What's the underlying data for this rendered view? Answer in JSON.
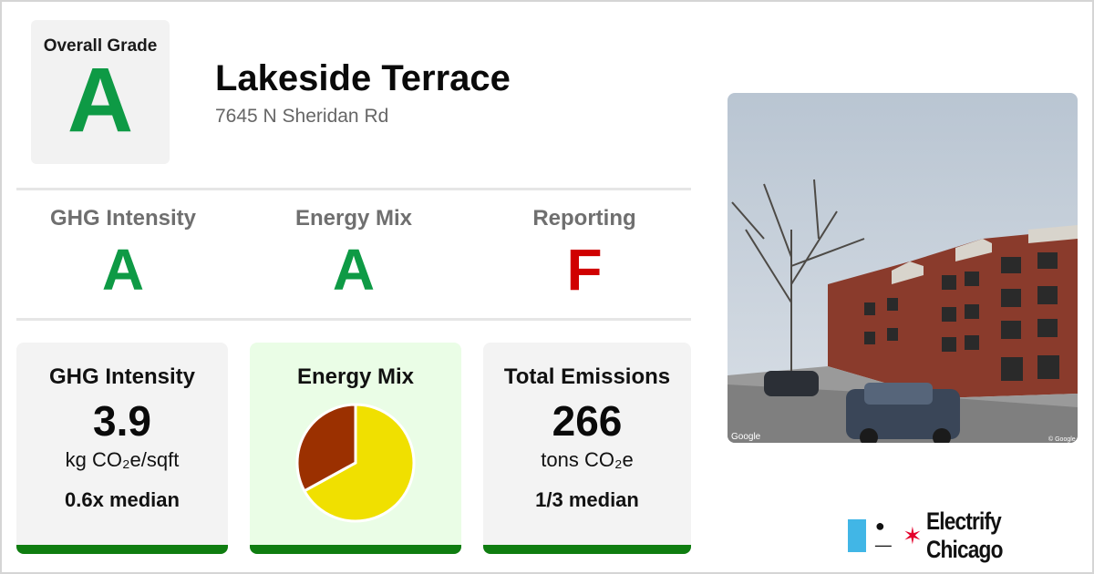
{
  "overall": {
    "label": "Overall Grade",
    "grade": "A",
    "grade_color": "#0e9a45"
  },
  "building": {
    "name": "Lakeside Terrace",
    "address": "7645 N Sheridan Rd"
  },
  "grades": [
    {
      "label": "GHG Intensity",
      "value": "A",
      "color": "#0e9a45"
    },
    {
      "label": "Energy Mix",
      "value": "A",
      "color": "#0e9a45"
    },
    {
      "label": "Reporting",
      "value": "F",
      "color": "#d00000"
    }
  ],
  "cards": {
    "ghg": {
      "title": "GHG Intensity",
      "value": "3.9",
      "unit": "kg CO₂e/sqft",
      "comparison": "0.6x median"
    },
    "mix": {
      "title": "Energy Mix",
      "chart_data": {
        "type": "pie",
        "slices": [
          {
            "share": 0.67,
            "color": "#f0e000"
          },
          {
            "share": 0.33,
            "color": "#9b3000"
          }
        ]
      }
    },
    "total": {
      "title": "Total Emissions",
      "value": "266",
      "unit": "tons CO₂e",
      "comparison": "1/3 median"
    }
  },
  "photo": {
    "watermark": "Google",
    "watermark_right": "© Google"
  },
  "brand": {
    "name": "Electrify Chicago",
    "icon": "plug-icon",
    "star_icon": "red-star-icon",
    "flag_color": "#41b6e6"
  },
  "colors": {
    "bar": "#0f7d10",
    "card_green": "#eafde6"
  }
}
